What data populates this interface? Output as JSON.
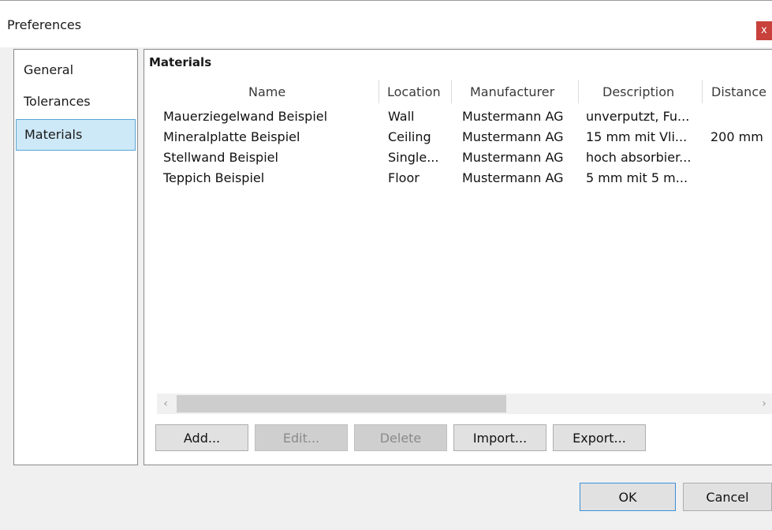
{
  "window": {
    "title": "Preferences",
    "close_label": "x"
  },
  "sidebar": {
    "items": [
      {
        "label": "General"
      },
      {
        "label": "Tolerances"
      },
      {
        "label": "Materials",
        "selected": true
      }
    ]
  },
  "materials": {
    "title": "Materials",
    "columns": [
      "Name",
      "Location",
      "Manufacturer",
      "Description",
      "Distance"
    ],
    "rows": [
      [
        "Mauerziegelwand Beispiel",
        "Wall",
        "Mustermann AG",
        "unverputzt, Fu...",
        ""
      ],
      [
        "Mineralplatte Beispiel",
        "Ceiling",
        "Mustermann AG",
        "15 mm mit Vli...",
        "200 mm"
      ],
      [
        "Stellwand Beispiel",
        "Single...",
        "Mustermann AG",
        "hoch absorbier...",
        ""
      ],
      [
        "Teppich Beispiel",
        "Floor",
        "Mustermann AG",
        "5 mm mit 5 m...",
        ""
      ]
    ],
    "buttons": {
      "add": "Add...",
      "edit": "Edit...",
      "delete": "Delete",
      "import": "Import...",
      "export": "Export..."
    }
  },
  "scrollbar": {
    "left_arrow": "‹",
    "right_arrow": "›"
  },
  "footer": {
    "ok": "OK",
    "cancel": "Cancel"
  },
  "colors": {
    "selected_bg": "#cde8f7",
    "selected_border": "#5aa6d6",
    "close_bg": "#c8413b"
  }
}
